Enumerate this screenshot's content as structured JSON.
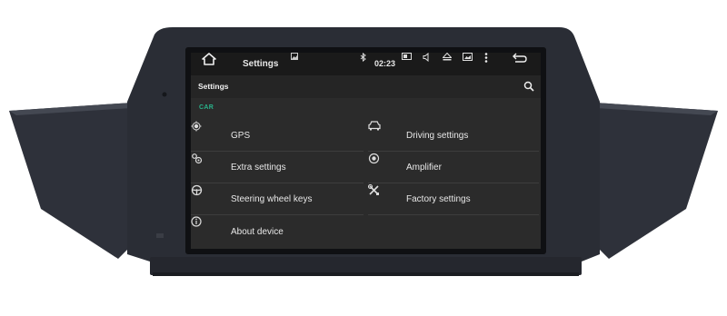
{
  "status_bar": {
    "title": "Settings",
    "time": "02:23"
  },
  "app_bar": {
    "title": "Settings"
  },
  "section": {
    "header": "CAR"
  },
  "settings": {
    "gps": "GPS",
    "driving": "Driving settings",
    "extra": "Extra settings",
    "amplifier": "Amplifier",
    "steering": "Steering wheel keys",
    "factory": "Factory settings",
    "about": "About device"
  },
  "colors": {
    "accent": "#29b38a",
    "screen_bg": "#2b2b2b",
    "status_bg": "#1a1a1a",
    "bezel": "#2c2f38"
  }
}
